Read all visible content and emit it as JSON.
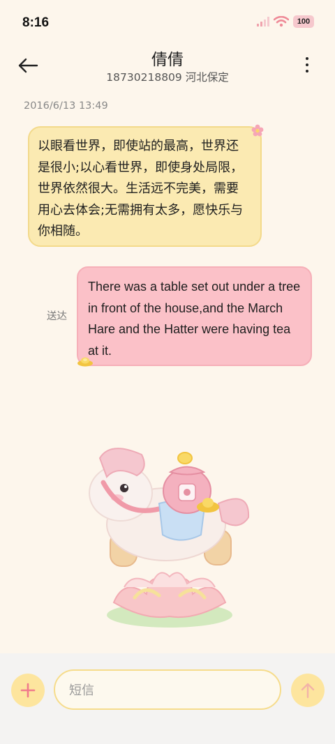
{
  "status": {
    "time": "8:16",
    "battery": "100"
  },
  "header": {
    "name": "倩倩",
    "subtitle": "18730218809 河北保定"
  },
  "conversation": {
    "timestamp": "2016/6/13 13:49",
    "incoming_text": "以眼看世界，即使站的最高，世界还是很小;以心看世界，即使身处局限，世界依然很大。生活远不完美，需要用心去体会;无需拥有太多，愿快乐与你相随。",
    "outgoing_text": "There was a table set out under a tree in front of the house,and the March Hare and the Hatter were having tea at it.",
    "delivered_label": "送达"
  },
  "composer": {
    "placeholder": "短信"
  },
  "colors": {
    "background": "#fdf6ec",
    "incoming_bubble": "#fbeab2",
    "outgoing_bubble": "#fbc1c8",
    "accent": "#fde59e",
    "accent_icon": "#f07a8c"
  },
  "icons": {
    "back": "arrow-left-icon",
    "more": "more-vertical-icon",
    "add": "plus-icon",
    "send": "arrow-up-icon",
    "signal": "signal-icon",
    "wifi": "wifi-icon",
    "battery": "battery-icon"
  }
}
